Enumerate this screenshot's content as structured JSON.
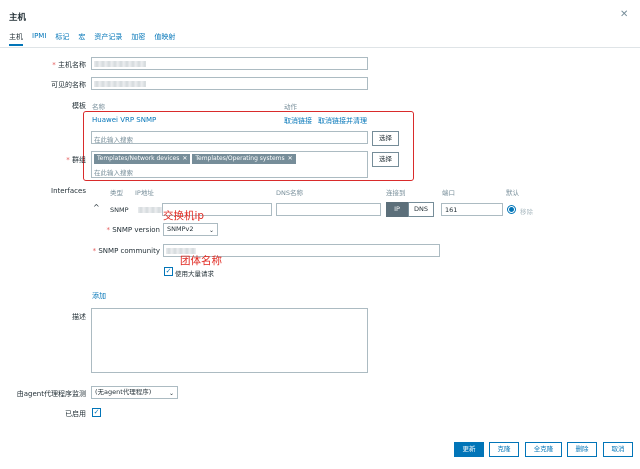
{
  "dialog": {
    "title": "主机"
  },
  "tabs": [
    {
      "label": "主机"
    },
    {
      "label": "IPMI"
    },
    {
      "label": "标记"
    },
    {
      "label": "宏"
    },
    {
      "label": "资产记录"
    },
    {
      "label": "加密"
    },
    {
      "label": "值映射"
    }
  ],
  "form": {
    "hostname_label": "主机名称",
    "visible_name_label": "可见的名称",
    "templates_label": "模板",
    "templates_col_name": "名称",
    "templates_col_action": "动作",
    "template_linked": "Huawei VRP SNMP",
    "unlink_label": "取消链接",
    "unlink_clear_label": "取消链接并清理",
    "template_search_placeholder": "在此输入搜索",
    "select_label": "选择",
    "groups_label": "群组",
    "groups": [
      "Templates/Network devices",
      "Templates/Operating systems"
    ],
    "groups_search_placeholder": "在此输入搜索",
    "groups_select_label": "选择",
    "interfaces_label": "Interfaces",
    "iface_col_type": "类型",
    "iface_col_ip": "IP地址",
    "iface_col_dns": "DNS名称",
    "iface_col_connect": "连接到",
    "iface_col_port": "端口",
    "iface_col_default": "默认",
    "iface_type_value": "SNMP",
    "connect_ip": "IP",
    "connect_dns": "DNS",
    "port_value": "161",
    "remove_label": "移除",
    "snmp_version_label": "SNMP version",
    "snmp_version_value": "SNMPv2",
    "snmp_community_label": "SNMP community",
    "bulk_label": "使用大量请求",
    "add_label": "添加",
    "description_label": "描述",
    "proxy_label": "由agent代理程序监测",
    "proxy_value": "(无agent代理程序)",
    "enabled_label": "已启用"
  },
  "annotations": {
    "switch_ip": "交换机ip",
    "community_name": "团体名称"
  },
  "footer": {
    "update": "更新",
    "clone": "克隆",
    "full_clone": "全克隆",
    "delete": "删除",
    "cancel": "取消"
  },
  "colors": {
    "accent": "#0275b8",
    "annotation": "#e0271f"
  }
}
